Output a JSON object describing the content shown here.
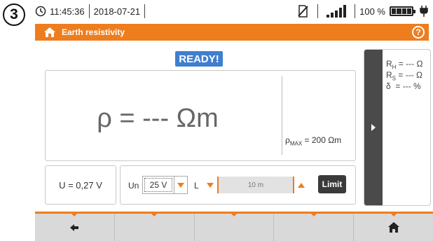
{
  "step_number": "3",
  "status": {
    "time": "11:45:36",
    "date": "2018-07-21",
    "battery_percent": "100 %",
    "icons": [
      "clock-icon",
      "sd-card-icon",
      "signal-icon",
      "battery-icon",
      "plug-icon"
    ]
  },
  "header": {
    "title": "Earth resistivity",
    "help_label": "?",
    "accent_color": "#ee7d1e"
  },
  "ready_label": "READY!",
  "measurement": {
    "main_reading": "ρ = --- Ωm",
    "rho_max_symbol": "ρ",
    "rho_max_sub": "MAX",
    "rho_max_value": " = 200 Ωm"
  },
  "side_results": [
    {
      "symbol": "R",
      "sub": "H",
      "value": " = --- Ω"
    },
    {
      "symbol": "R",
      "sub": "S",
      "value": " = --- Ω"
    },
    {
      "symbol": "δ",
      "sub": "",
      "value": "  = --- %"
    }
  ],
  "voltage_reading": "U = 0,27 V",
  "controls": {
    "un_label": "Un",
    "un_value": "25 V",
    "l_label": "L",
    "l_value": "10 m",
    "limit_label": "Limit"
  },
  "bottom_bar": [
    {
      "icon": "back-arrow-icon"
    },
    {
      "icon": ""
    },
    {
      "icon": ""
    },
    {
      "icon": ""
    },
    {
      "icon": "home-icon"
    }
  ]
}
